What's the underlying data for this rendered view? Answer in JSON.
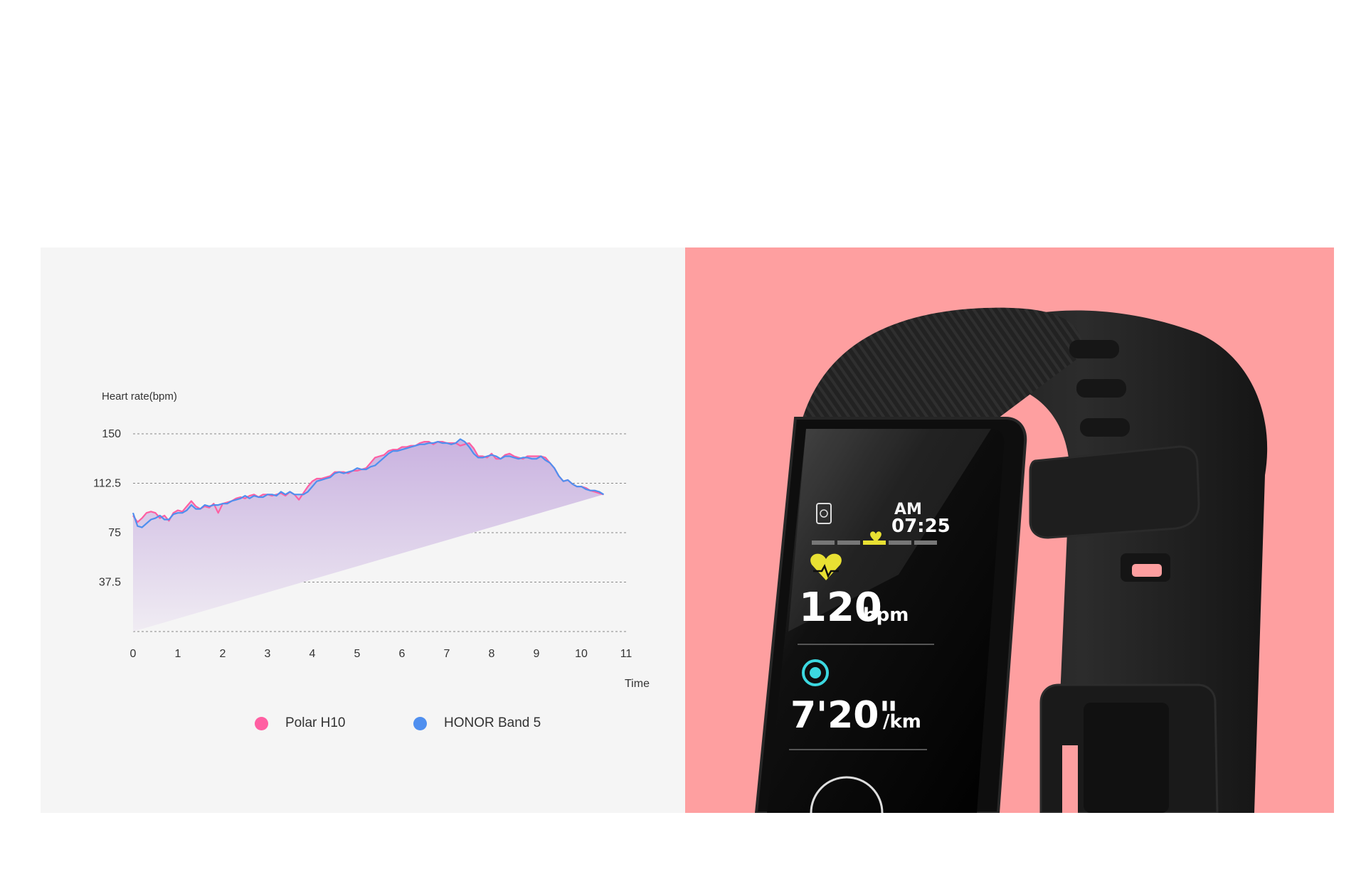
{
  "chart_data": {
    "type": "line",
    "ylabel": "Heart rate(bpm)",
    "xlabel": "Time",
    "x_ticks": [
      "0",
      "1",
      "2",
      "3",
      "4",
      "5",
      "6",
      "7",
      "8",
      "9",
      "10",
      "11"
    ],
    "y_ticks": [
      "37.5",
      "75",
      "112.5",
      "150"
    ],
    "xlim": [
      0,
      11
    ],
    "ylim": [
      0,
      150
    ],
    "grid": "horizontal dashed",
    "area_fill": true,
    "x": [
      0,
      0.1,
      0.2,
      0.3,
      0.4,
      0.5,
      0.6,
      0.7,
      0.8,
      0.9,
      1.0,
      1.1,
      1.2,
      1.3,
      1.4,
      1.5,
      1.6,
      1.7,
      1.8,
      1.9,
      2.0,
      2.1,
      2.2,
      2.3,
      2.4,
      2.5,
      2.6,
      2.7,
      2.8,
      2.9,
      3.0,
      3.1,
      3.2,
      3.3,
      3.4,
      3.5,
      3.6,
      3.7,
      3.8,
      3.9,
      4.0,
      4.1,
      4.2,
      4.3,
      4.4,
      4.5,
      4.6,
      4.7,
      4.8,
      4.9,
      5.0,
      5.1,
      5.2,
      5.3,
      5.4,
      5.5,
      5.6,
      5.7,
      5.8,
      5.9,
      6.0,
      6.1,
      6.2,
      6.3,
      6.4,
      6.5,
      6.6,
      6.7,
      6.8,
      6.9,
      7.0,
      7.1,
      7.2,
      7.3,
      7.4,
      7.5,
      7.6,
      7.7,
      7.8,
      7.9,
      8.0,
      8.1,
      8.2,
      8.3,
      8.4,
      8.5,
      8.6,
      8.7,
      8.8,
      8.9,
      9.0,
      9.1,
      9.2,
      9.3,
      9.4,
      9.5,
      9.6,
      9.7,
      9.8,
      9.9,
      10.0,
      10.1,
      10.2,
      10.3,
      10.4,
      10.5,
      10.6,
      10.7,
      10.8,
      10.9,
      11.0
    ],
    "series": [
      {
        "name": "Polar H10",
        "color": "#ff5fa2",
        "values": [
          88,
          83,
          86,
          90,
          91,
          90,
          86,
          88,
          84,
          90,
          92,
          91,
          95,
          99,
          95,
          93,
          95,
          94,
          97,
          90,
          97,
          98,
          99,
          101,
          102,
          101,
          103,
          104,
          102,
          104,
          104,
          103,
          104,
          105,
          103,
          106,
          104,
          100,
          105,
          110,
          114,
          116,
          116,
          117,
          118,
          121,
          121,
          121,
          120,
          122,
          122,
          123,
          124,
          128,
          132,
          133,
          134,
          137,
          138,
          138,
          140,
          140,
          141,
          141,
          143,
          144,
          144,
          142,
          144,
          144,
          143,
          143,
          143,
          141,
          142,
          143,
          139,
          133,
          133,
          132,
          135,
          131,
          131,
          134,
          135,
          133,
          132,
          131,
          133,
          133,
          133,
          133,
          132,
          128,
          124,
          118,
          114,
          115,
          112,
          110,
          110,
          109,
          107,
          106,
          105,
          104
        ]
      },
      {
        "name": "HONOR Band 5",
        "color": "#4f8fef",
        "values": [
          90,
          80,
          79,
          82,
          85,
          86,
          88,
          85,
          85,
          89,
          90,
          90,
          92,
          96,
          93,
          93,
          96,
          95,
          96,
          96,
          97,
          97,
          99,
          100,
          101,
          103,
          101,
          103,
          102,
          102,
          104,
          104,
          103,
          106,
          104,
          106,
          104,
          104,
          104,
          106,
          110,
          114,
          115,
          116,
          117,
          120,
          121,
          120,
          121,
          122,
          124,
          123,
          123,
          125,
          126,
          129,
          132,
          135,
          137,
          137,
          138,
          139,
          140,
          141,
          142,
          142,
          143,
          143,
          144,
          143,
          143,
          142,
          143,
          146,
          144,
          140,
          135,
          132,
          132,
          133,
          134,
          133,
          131,
          133,
          133,
          132,
          131,
          132,
          132,
          131,
          131,
          133,
          130,
          128,
          124,
          118,
          114,
          115,
          112,
          110,
          110,
          108,
          107,
          107,
          106,
          104
        ]
      }
    ]
  },
  "legend": {
    "items": [
      {
        "label": "Polar H10",
        "color": "#ff5fa2"
      },
      {
        "label": "HONOR Band 5",
        "color": "#4f8fef"
      }
    ]
  },
  "colors": {
    "chart_panel_bg": "#f5f5f5",
    "product_panel_bg": "#fe9fa0",
    "area_top": "#c9b2e0",
    "area_bottom": "#f0ecf3"
  },
  "band_screen": {
    "time_period": "AM",
    "time": "07:25",
    "heart_rate_value": "120",
    "heart_rate_unit": "bpm",
    "pace_value": "7'20\"",
    "pace_unit": "/km",
    "icons": [
      "watch-face-icon",
      "heart-icon",
      "speedometer-icon"
    ]
  }
}
